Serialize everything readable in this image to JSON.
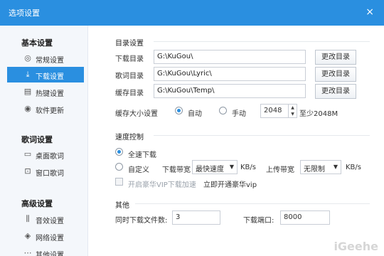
{
  "window": {
    "title": "选项设置",
    "close_icon": "×"
  },
  "sidebar": {
    "groups": [
      {
        "title": "基本设置",
        "items": [
          {
            "label": "常规设置",
            "icon": "◎"
          },
          {
            "label": "下载设置",
            "icon": "⤓"
          },
          {
            "label": "热键设置",
            "icon": "▤"
          },
          {
            "label": "软件更新",
            "icon": "◉"
          }
        ]
      },
      {
        "title": "歌词设置",
        "items": [
          {
            "label": "桌面歌词",
            "icon": "▭"
          },
          {
            "label": "窗口歌词",
            "icon": "⊡"
          }
        ]
      },
      {
        "title": "高级设置",
        "items": [
          {
            "label": "音效设置",
            "icon": "⫼"
          },
          {
            "label": "网络设置",
            "icon": "◈"
          },
          {
            "label": "其他设置",
            "icon": "⋯"
          }
        ]
      }
    ],
    "active": "下载设置"
  },
  "dir_section": {
    "title": "目录设置",
    "rows": [
      {
        "label": "下载目录",
        "path": "G:\\KuGou\\",
        "button": "更改目录"
      },
      {
        "label": "歌词目录",
        "path": "G:\\KuGou\\Lyric\\",
        "button": "更改目录"
      },
      {
        "label": "缓存目录",
        "path": "G:\\KuGou\\Temp\\",
        "button": "更改目录"
      }
    ],
    "cache": {
      "label": "缓存大小设置",
      "auto": "自动",
      "manual": "手动",
      "value": "2048",
      "hint": "至少2048M",
      "selected": "auto"
    }
  },
  "speed_section": {
    "title": "速度控制",
    "full_speed": "全速下载",
    "custom": "自定义",
    "down_label": "下载带宽",
    "down_value": "最快速度",
    "down_unit": "KB/s",
    "up_label": "上传带宽",
    "up_value": "无限制",
    "up_unit": "KB/s",
    "vip_check": "开启豪华VIP下载加速",
    "vip_link": "立即开通豪华vip"
  },
  "other_section": {
    "title": "其他",
    "concurrent_label": "同时下载文件数:",
    "concurrent_value": "3",
    "port_label": "下载端口:",
    "port_value": "8000"
  },
  "colors": {
    "accent": "#2a8fe0",
    "sidebar_bg": "#f4f7fb"
  },
  "watermark": "iGeehe"
}
